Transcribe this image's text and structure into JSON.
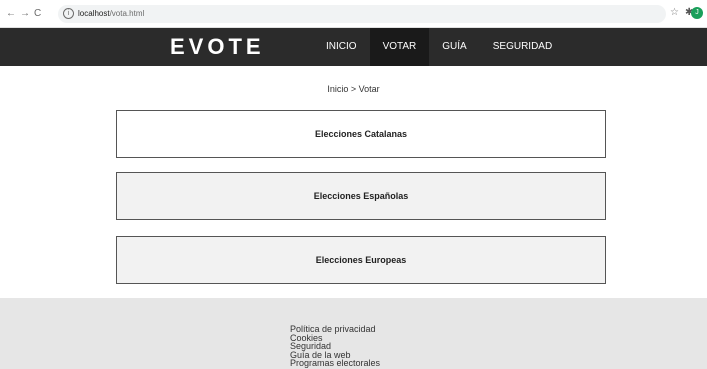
{
  "browser": {
    "back": "←",
    "forward": "→",
    "reload": "C",
    "url_host": "localhost",
    "url_path": "/vota.html",
    "avatar_letter": "J"
  },
  "header": {
    "logo": "EVOTE",
    "menu": [
      {
        "label": "INICIO"
      },
      {
        "label": "VOTAR"
      },
      {
        "label": "GUÍA"
      },
      {
        "label": "SEGURIDAD"
      }
    ]
  },
  "breadcrumb": "Inicio > Votar",
  "elections": [
    {
      "label": "Elecciones Catalanas"
    },
    {
      "label": "Elecciones Españolas"
    },
    {
      "label": "Elecciones Europeas"
    }
  ],
  "footer": {
    "links": [
      "Política de privacidad",
      "Cookies",
      "Seguridad",
      "Guía de la web",
      "Programas electorales"
    ]
  },
  "icons": {
    "info": "info-icon",
    "star": "star-icon",
    "extension": "puzzle-icon"
  },
  "colors": {
    "header_bg": "#2b2b2b",
    "active_menu_bg": "#1a1a1a",
    "footer_bg": "#e6e6e6",
    "avatar": "#1a9f5a"
  }
}
